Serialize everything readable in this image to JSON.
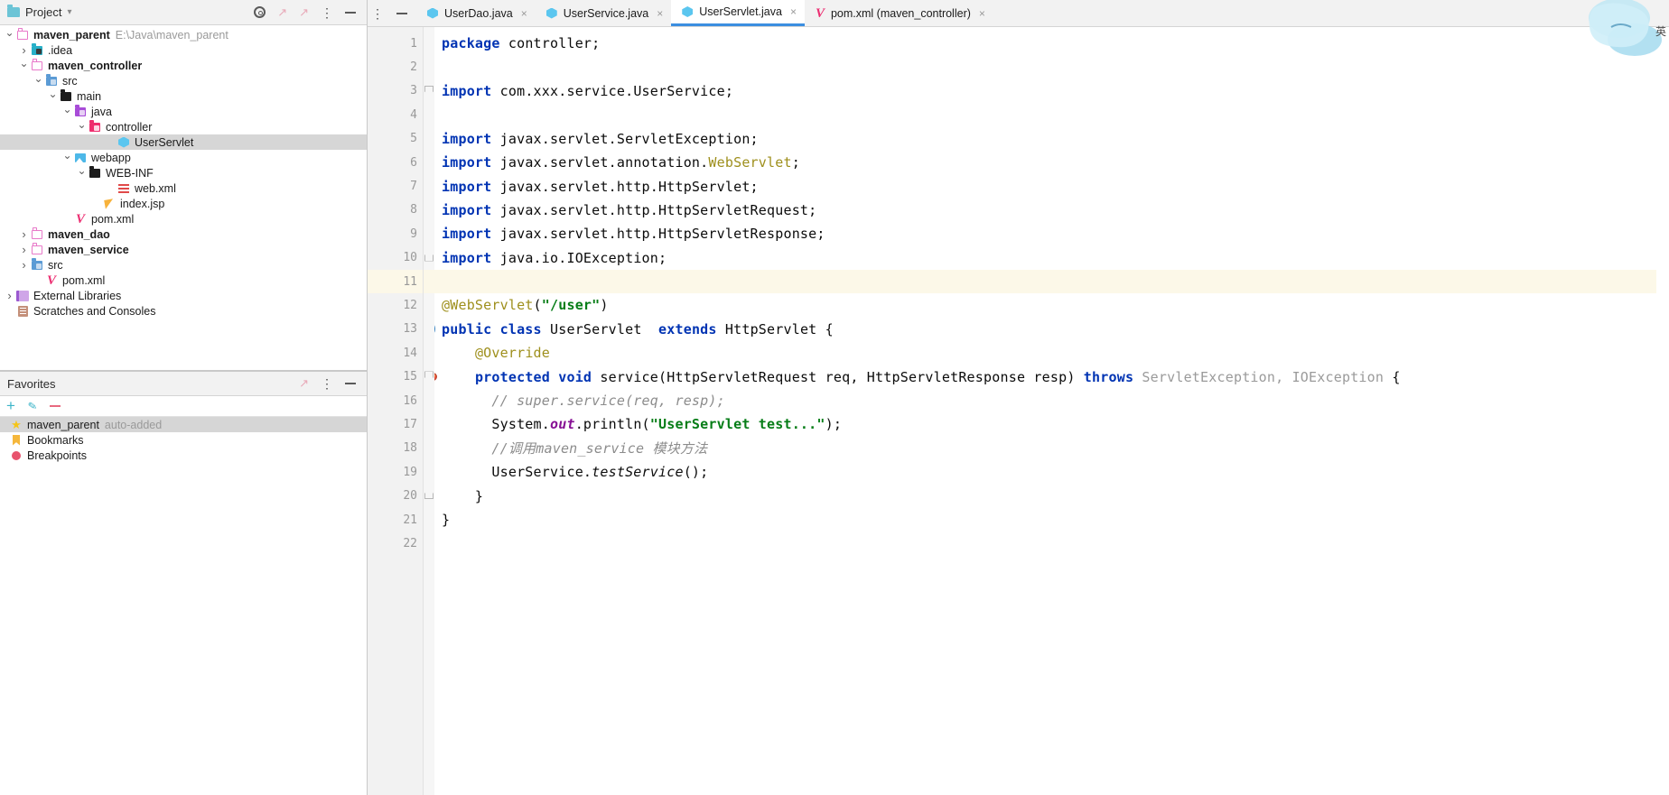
{
  "window": {
    "ime_badge": "英"
  },
  "project_panel": {
    "title": "Project",
    "title_chevron": "chevron-down",
    "toolbar_icons": [
      "locate-target-icon",
      "expand-arrow-icon",
      "collapse-arrow-icon",
      "options-menu-icon",
      "hide-panel-icon"
    ],
    "tree": [
      {
        "indent": 0,
        "twisty": "expanded",
        "icon": "folder-outline-icon",
        "label": "maven_parent",
        "bold": true,
        "sub": "E:\\Java\\maven_parent",
        "selected": false
      },
      {
        "indent": 1,
        "twisty": "collapsed",
        "icon": "folder-idea-icon",
        "label": ".idea",
        "bold": false,
        "sub": "",
        "selected": false
      },
      {
        "indent": 1,
        "twisty": "expanded",
        "icon": "folder-outline-icon",
        "label": "maven_controller",
        "bold": true,
        "sub": "",
        "selected": false
      },
      {
        "indent": 2,
        "twisty": "expanded",
        "icon": "folder-source-icon",
        "label": "src",
        "bold": false,
        "sub": "",
        "selected": false
      },
      {
        "indent": 3,
        "twisty": "expanded",
        "icon": "folder-black-icon",
        "label": "main",
        "bold": false,
        "sub": "",
        "selected": false
      },
      {
        "indent": 4,
        "twisty": "expanded",
        "icon": "folder-java-icon",
        "label": "java",
        "bold": false,
        "sub": "",
        "selected": false
      },
      {
        "indent": 5,
        "twisty": "expanded",
        "icon": "folder-package-icon",
        "label": "controller",
        "bold": false,
        "sub": "",
        "selected": false
      },
      {
        "indent": 7,
        "twisty": "none",
        "icon": "java-class-icon",
        "label": "UserServlet",
        "bold": false,
        "sub": "",
        "selected": true
      },
      {
        "indent": 4,
        "twisty": "expanded",
        "icon": "folder-webapp-icon",
        "label": "webapp",
        "bold": false,
        "sub": "",
        "selected": false
      },
      {
        "indent": 5,
        "twisty": "expanded",
        "icon": "folder-black-icon",
        "label": "WEB-INF",
        "bold": false,
        "sub": "",
        "selected": false
      },
      {
        "indent": 7,
        "twisty": "none",
        "icon": "xml-file-icon",
        "label": "web.xml",
        "bold": false,
        "sub": "",
        "selected": false
      },
      {
        "indent": 6,
        "twisty": "none",
        "icon": "jsp-file-icon",
        "label": "index.jsp",
        "bold": false,
        "sub": "",
        "selected": false
      },
      {
        "indent": 4,
        "twisty": "none",
        "icon": "maven-pom-icon",
        "label": "pom.xml",
        "bold": false,
        "sub": "",
        "selected": false
      },
      {
        "indent": 1,
        "twisty": "collapsed",
        "icon": "folder-outline-icon",
        "label": "maven_dao",
        "bold": true,
        "sub": "",
        "selected": false
      },
      {
        "indent": 1,
        "twisty": "collapsed",
        "icon": "folder-outline-icon",
        "label": "maven_service",
        "bold": true,
        "sub": "",
        "selected": false
      },
      {
        "indent": 1,
        "twisty": "collapsed",
        "icon": "folder-source-icon",
        "label": "src",
        "bold": false,
        "sub": "",
        "selected": false
      },
      {
        "indent": 2,
        "twisty": "none",
        "icon": "maven-pom-icon",
        "label": "pom.xml",
        "bold": false,
        "sub": "",
        "selected": false
      },
      {
        "indent": 0,
        "twisty": "collapsed",
        "icon": "external-libraries-icon",
        "label": "External Libraries",
        "bold": false,
        "sub": "",
        "selected": false
      },
      {
        "indent": 0,
        "twisty": "none",
        "icon": "scratches-icon",
        "label": "Scratches and Consoles",
        "bold": false,
        "sub": "",
        "selected": false
      }
    ]
  },
  "favorites_panel": {
    "title": "Favorites",
    "toolbar": [
      {
        "name": "add-favorite-button",
        "glyph": "+"
      },
      {
        "name": "edit-favorite-button",
        "glyph": "pencil"
      },
      {
        "name": "remove-favorite-button",
        "glyph": "minus"
      }
    ],
    "items": [
      {
        "icon": "star-icon",
        "label": "maven_parent",
        "sub": "auto-added",
        "selected": true
      },
      {
        "icon": "bookmark-icon",
        "label": "Bookmarks",
        "sub": "",
        "selected": false
      },
      {
        "icon": "breakpoint-icon",
        "label": "Breakpoints",
        "sub": "",
        "selected": false
      }
    ]
  },
  "editor": {
    "tabs": [
      {
        "icon": "java-class-icon",
        "label": "UserDao.java",
        "active": false,
        "close": "×"
      },
      {
        "icon": "java-class-icon",
        "label": "UserService.java",
        "active": false,
        "close": "×"
      },
      {
        "icon": "java-class-icon",
        "label": "UserServlet.java",
        "active": true,
        "close": "×"
      },
      {
        "icon": "maven-pom-icon",
        "label": "pom.xml (maven_controller)",
        "active": false,
        "close": "×"
      }
    ],
    "active_file": "UserServlet.java",
    "line_numbers": [
      "1",
      "2",
      "3",
      "4",
      "5",
      "6",
      "7",
      "8",
      "9",
      "10",
      "11",
      "12",
      "13",
      "14",
      "15",
      "16",
      "17",
      "18",
      "19",
      "20",
      "21",
      "22"
    ],
    "caret_line": 11,
    "gutter_markers": [
      {
        "line": 13,
        "icon": "run-class-icon"
      },
      {
        "line": 15,
        "icon": "override-method-icon"
      }
    ],
    "fold_markers": [
      {
        "line": 3,
        "type": "fold-top"
      },
      {
        "line": 10,
        "type": "fold-bottom"
      },
      {
        "line": 15,
        "type": "fold-top"
      },
      {
        "line": 20,
        "type": "fold-bottom"
      }
    ],
    "code": [
      {
        "n": 1,
        "tokens": [
          {
            "t": "package",
            "c": "kw"
          },
          {
            "t": " controller;",
            "c": "plain"
          }
        ]
      },
      {
        "n": 2,
        "tokens": []
      },
      {
        "n": 3,
        "tokens": [
          {
            "t": "import",
            "c": "kw"
          },
          {
            "t": " com.xxx.service.UserService;",
            "c": "plain"
          }
        ]
      },
      {
        "n": 4,
        "tokens": []
      },
      {
        "n": 5,
        "tokens": [
          {
            "t": "import",
            "c": "kw"
          },
          {
            "t": " javax.servlet.ServletException;",
            "c": "plain"
          }
        ]
      },
      {
        "n": 6,
        "tokens": [
          {
            "t": "import",
            "c": "kw"
          },
          {
            "t": " javax.servlet.annotation.",
            "c": "plain"
          },
          {
            "t": "WebServlet",
            "c": "ann"
          },
          {
            "t": ";",
            "c": "plain"
          }
        ]
      },
      {
        "n": 7,
        "tokens": [
          {
            "t": "import",
            "c": "kw"
          },
          {
            "t": " javax.servlet.http.HttpServlet;",
            "c": "plain"
          }
        ]
      },
      {
        "n": 8,
        "tokens": [
          {
            "t": "import",
            "c": "kw"
          },
          {
            "t": " javax.servlet.http.HttpServletRequest;",
            "c": "plain"
          }
        ]
      },
      {
        "n": 9,
        "tokens": [
          {
            "t": "import",
            "c": "kw"
          },
          {
            "t": " javax.servlet.http.HttpServletResponse;",
            "c": "plain"
          }
        ]
      },
      {
        "n": 10,
        "tokens": [
          {
            "t": "import",
            "c": "kw"
          },
          {
            "t": " java.io.IOException;",
            "c": "plain"
          }
        ]
      },
      {
        "n": 11,
        "tokens": []
      },
      {
        "n": 12,
        "tokens": [
          {
            "t": "@WebServlet",
            "c": "ann"
          },
          {
            "t": "(",
            "c": "plain"
          },
          {
            "t": "\"/user\"",
            "c": "str"
          },
          {
            "t": ")",
            "c": "plain"
          }
        ]
      },
      {
        "n": 13,
        "tokens": [
          {
            "t": "public class",
            "c": "kw"
          },
          {
            "t": " UserServlet  ",
            "c": "plain"
          },
          {
            "t": "extends",
            "c": "kw"
          },
          {
            "t": " HttpServlet {",
            "c": "plain"
          }
        ]
      },
      {
        "n": 14,
        "tokens": [
          {
            "t": "    ",
            "c": "plain"
          },
          {
            "t": "@Override",
            "c": "ann"
          }
        ]
      },
      {
        "n": 15,
        "tokens": [
          {
            "t": "    ",
            "c": "plain"
          },
          {
            "t": "protected void",
            "c": "kw"
          },
          {
            "t": " service(HttpServletRequest req, HttpServletResponse resp) ",
            "c": "plain"
          },
          {
            "t": "throws",
            "c": "kw"
          },
          {
            "t": " ",
            "c": "plain"
          },
          {
            "t": "ServletException, IOException",
            "c": "grey"
          },
          {
            "t": " {",
            "c": "plain"
          }
        ]
      },
      {
        "n": 16,
        "tokens": [
          {
            "t": "      // super.service(req, resp);",
            "c": "cmt"
          }
        ]
      },
      {
        "n": 17,
        "tokens": [
          {
            "t": "      System.",
            "c": "plain"
          },
          {
            "t": "out",
            "c": "stat"
          },
          {
            "t": ".println(",
            "c": "plain"
          },
          {
            "t": "\"UserServlet test...\"",
            "c": "str"
          },
          {
            "t": ");",
            "c": "plain"
          }
        ]
      },
      {
        "n": 18,
        "tokens": [
          {
            "t": "      //调用maven_service 模块方法",
            "c": "cmt"
          }
        ]
      },
      {
        "n": 19,
        "tokens": [
          {
            "t": "      UserService.",
            "c": "plain"
          },
          {
            "t": "testService",
            "c": "mth"
          },
          {
            "t": "();",
            "c": "plain"
          }
        ]
      },
      {
        "n": 20,
        "tokens": [
          {
            "t": "    }",
            "c": "plain"
          }
        ]
      },
      {
        "n": 21,
        "tokens": [
          {
            "t": "}",
            "c": "plain"
          }
        ]
      },
      {
        "n": 22,
        "tokens": []
      }
    ]
  },
  "colors": {
    "keyword": "#0033b3",
    "string": "#067d17",
    "comment": "#8c8c8c",
    "annotation": "#9e8f1c",
    "static_field": "#871094",
    "greyed": "#9a9a9a",
    "tab_active_underline": "#3b8ee0",
    "caret_line_bg": "#fcf8e8",
    "selection_bg": "#d6d6d6"
  }
}
